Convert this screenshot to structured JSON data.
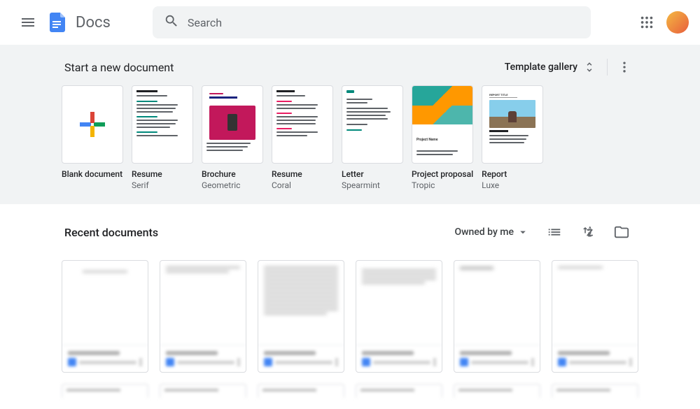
{
  "app_name": "Docs",
  "search": {
    "placeholder": "Search"
  },
  "templates": {
    "heading": "Start a new document",
    "gallery_label": "Template gallery",
    "items": [
      {
        "name": "Blank document",
        "subtitle": ""
      },
      {
        "name": "Resume",
        "subtitle": "Serif"
      },
      {
        "name": "Brochure",
        "subtitle": "Geometric"
      },
      {
        "name": "Resume",
        "subtitle": "Coral"
      },
      {
        "name": "Letter",
        "subtitle": "Spearmint"
      },
      {
        "name": "Project proposal",
        "subtitle": "Tropic"
      },
      {
        "name": "Report",
        "subtitle": "Luxe"
      }
    ]
  },
  "recent": {
    "heading": "Recent documents",
    "filter_label": "Owned by me"
  }
}
